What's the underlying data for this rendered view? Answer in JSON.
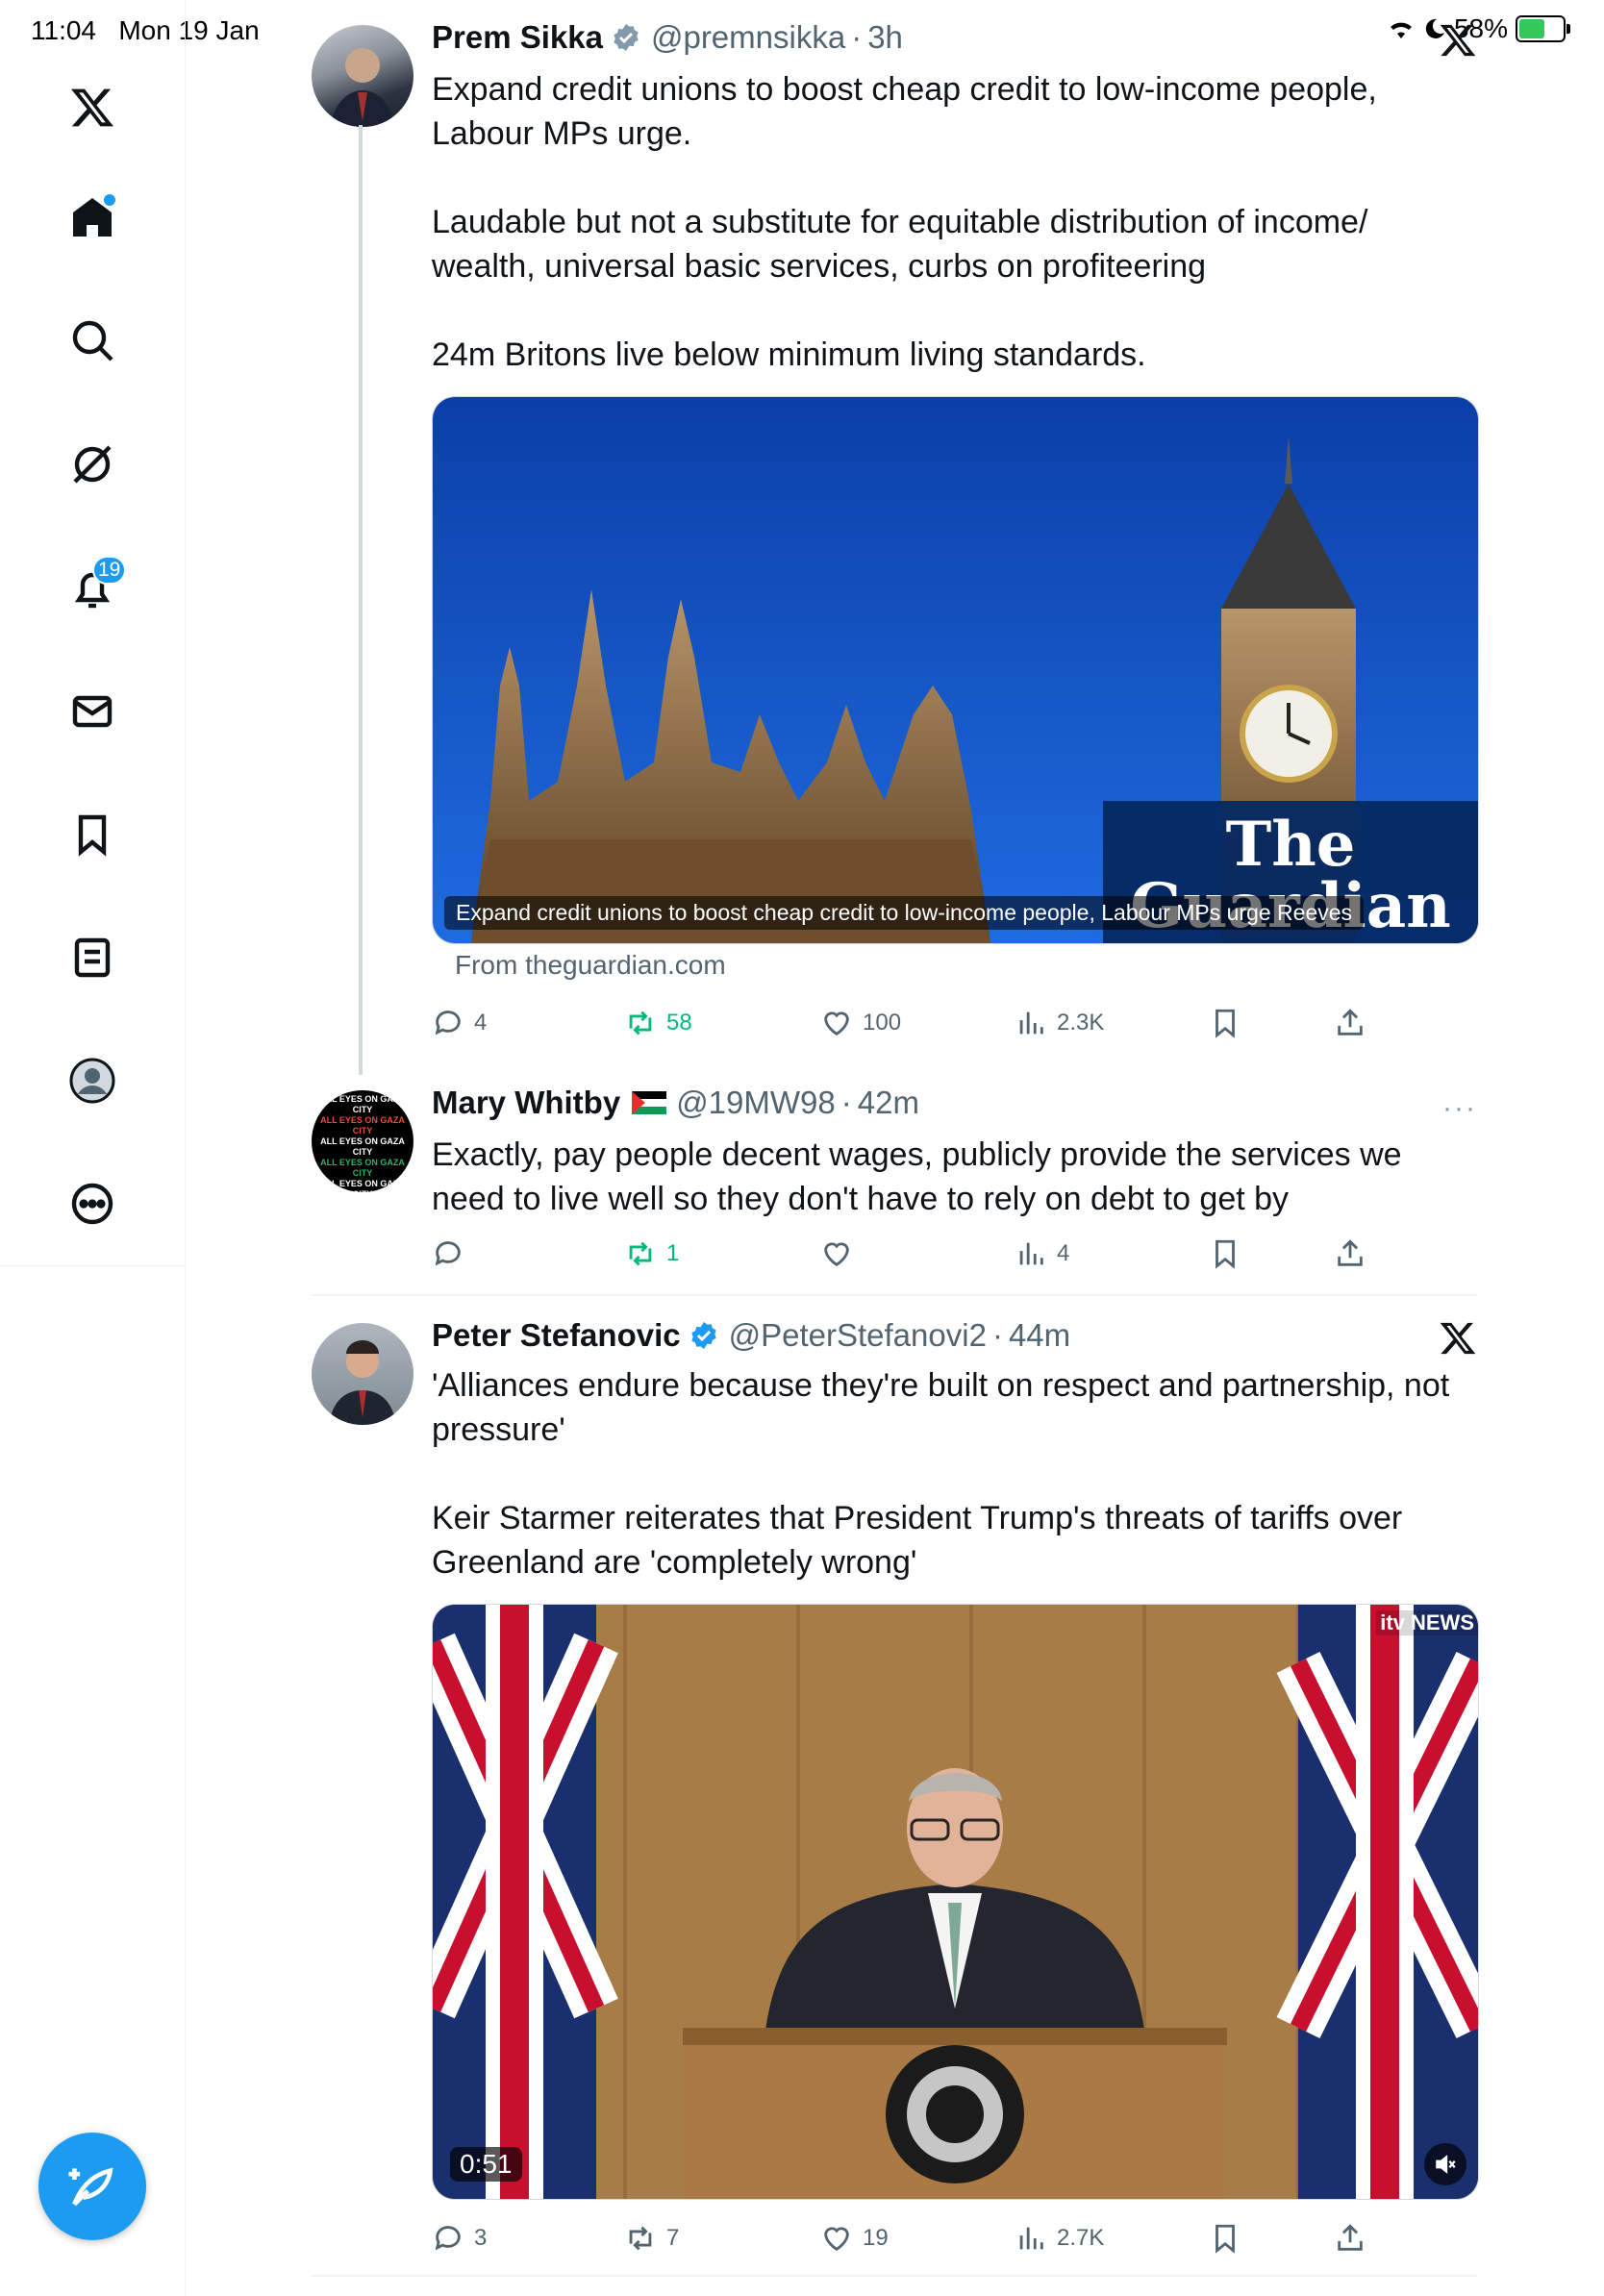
{
  "status_bar": {
    "time": "11:04",
    "date": "Mon 19 Jan",
    "battery": "58%",
    "battery_level": 0.58
  },
  "sidebar": {
    "items": [
      {
        "name": "x-logo"
      },
      {
        "name": "home"
      },
      {
        "name": "search"
      },
      {
        "name": "grok"
      },
      {
        "name": "notifications",
        "badge": "19"
      },
      {
        "name": "messages"
      },
      {
        "name": "bookmarks"
      },
      {
        "name": "lists"
      },
      {
        "name": "profile"
      },
      {
        "name": "more"
      }
    ]
  },
  "tweets": [
    {
      "name": "Prem Sikka",
      "handle": "@premnsikka",
      "time": "3h",
      "text": [
        "Expand credit unions to boost cheap credit to low-income people, Labour MPs urge.",
        "Laudable but not a substitute for equitable distribution of income/ wealth, universal basic services, curbs on profiteering",
        "24m Britons live below minimum living standards."
      ],
      "card": {
        "caption": "Expand credit unions to boost cheap credit to low-income people, Labour MPs urge Reeves",
        "logo_line1": "The",
        "logo_line2": "Guardian",
        "source": "From theguardian.com"
      },
      "stats": {
        "replies": "4",
        "reposts": "58",
        "likes": "100",
        "views": "2.3K"
      }
    },
    {
      "name": "Mary Whitby",
      "handle": "@19MW98",
      "time": "42m",
      "text": [
        "Exactly, pay people decent wages, publicly provide the services we need to live well so they don't have to rely on debt to get by"
      ],
      "avatar_text": "ALL EYES ON GAZA CITY",
      "stats": {
        "replies": "",
        "reposts": "1",
        "likes": "",
        "views": "4"
      }
    },
    {
      "name": "Peter Stefanovic",
      "handle": "@PeterStefanovi2",
      "time": "44m",
      "text": [
        "'Alliances endure because they're built on respect and partnership, not pressure'",
        "Keir Starmer reiterates that President Trump's threats of tariffs over Greenland are 'completely wrong'"
      ],
      "video": {
        "duration": "0:51",
        "watermark": "itv NEWS"
      },
      "stats": {
        "replies": "3",
        "reposts": "7",
        "likes": "19",
        "views": "2.7K"
      }
    }
  ],
  "colors": {
    "accent": "#1d9bf0",
    "repost_active": "#00ba7c",
    "secondary_text": "#536471"
  }
}
